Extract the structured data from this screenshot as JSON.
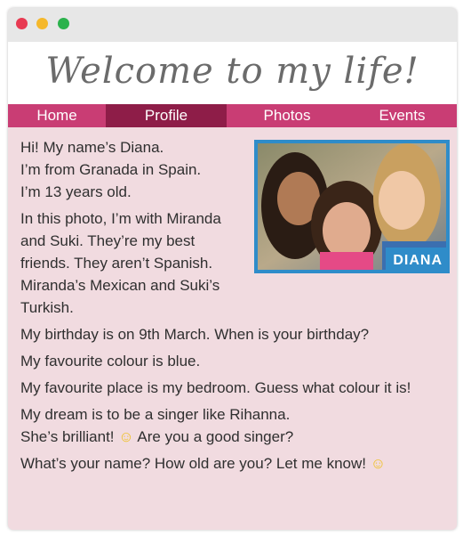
{
  "window": {
    "title": "Welcome to my life!"
  },
  "nav": {
    "items": [
      {
        "label": "Home"
      },
      {
        "label": "Profile"
      },
      {
        "label": "Photos"
      },
      {
        "label": "Events"
      }
    ],
    "active": "Profile"
  },
  "photo": {
    "tag": "DIANA",
    "border_color": "#2f8cc9"
  },
  "paragraphs": [
    "Hi! My name’s Diana.",
    "I’m from Granada in Spain.",
    "I’m 13 years old.",
    "In this photo, I’m with Miranda and Suki. They’re my best friends. They aren’t Spanish. Miranda’s Mexican and Suki’s Turkish.",
    "My birthday is on 9th March. When is your birthday?",
    "My favourite colour is blue.",
    "My favourite place is my bedroom. Guess what colour it is!",
    "My dream is to be a singer like Rihanna.",
    "She’s brilliant!",
    "Are you a good singer?",
    "What’s your name? How old are you? Let me know!"
  ],
  "colors": {
    "nav_bg": "#c93d74",
    "nav_active": "#8e1d48",
    "content_bg": "#f1dbe0",
    "title_color": "#6b6b6b"
  },
  "icons": {
    "smiley": "smiley-emoji-icon"
  }
}
